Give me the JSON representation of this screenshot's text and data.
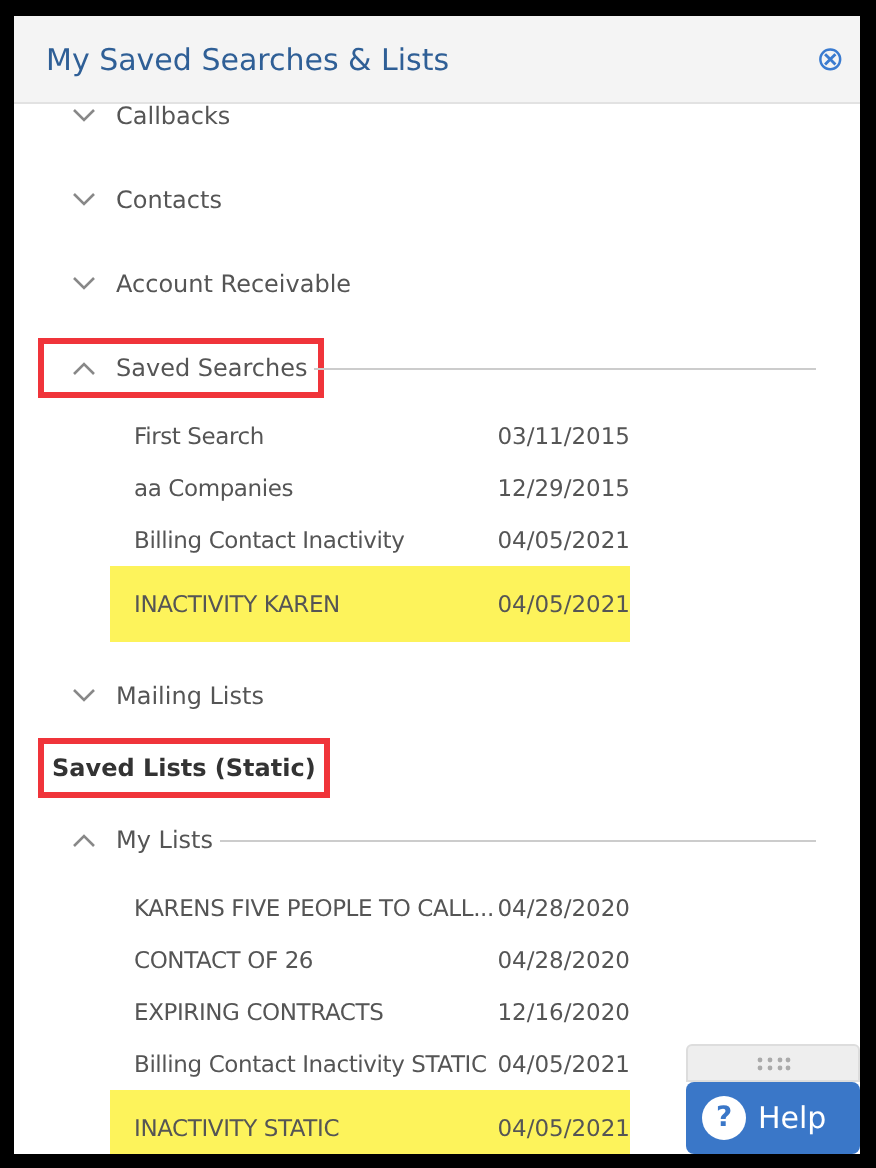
{
  "panel": {
    "title": "My Saved Searches & Lists",
    "close": "⊗"
  },
  "sections": [
    {
      "groups": [
        {
          "label": "Callbacks",
          "expanded": false
        },
        {
          "label": "Contacts",
          "expanded": false
        },
        {
          "label": "Account Receivable",
          "expanded": false
        },
        {
          "label": "Saved Searches",
          "expanded": true,
          "annotated": true,
          "items": [
            {
              "name": "First Search",
              "date": "03/11/2015",
              "highlighted": false
            },
            {
              "name": "aa Companies",
              "date": "12/29/2015",
              "highlighted": false
            },
            {
              "name": "Billing Contact Inactivity",
              "date": "04/05/2021",
              "highlighted": false
            },
            {
              "name": "INACTIVITY KAREN",
              "date": "04/05/2021",
              "highlighted": true
            }
          ]
        },
        {
          "label": "Mailing Lists",
          "expanded": false
        }
      ]
    },
    {
      "title": "Saved Lists (Static)",
      "annotated": true,
      "groups": [
        {
          "label": "My Lists",
          "expanded": true,
          "items": [
            {
              "name": "KARENS FIVE PEOPLE TO CALL...",
              "date": "04/28/2020",
              "highlighted": false
            },
            {
              "name": "CONTACT OF 26",
              "date": "04/28/2020",
              "highlighted": false
            },
            {
              "name": "EXPIRING CONTRACTS",
              "date": "12/16/2020",
              "highlighted": false
            },
            {
              "name": "Billing Contact Inactivity STATIC",
              "date": "04/05/2021",
              "highlighted": false
            },
            {
              "name": "INACTIVITY STATIC",
              "date": "04/05/2021",
              "highlighted": true
            }
          ]
        }
      ]
    }
  ],
  "help": {
    "label": "Help",
    "icon": "?"
  }
}
